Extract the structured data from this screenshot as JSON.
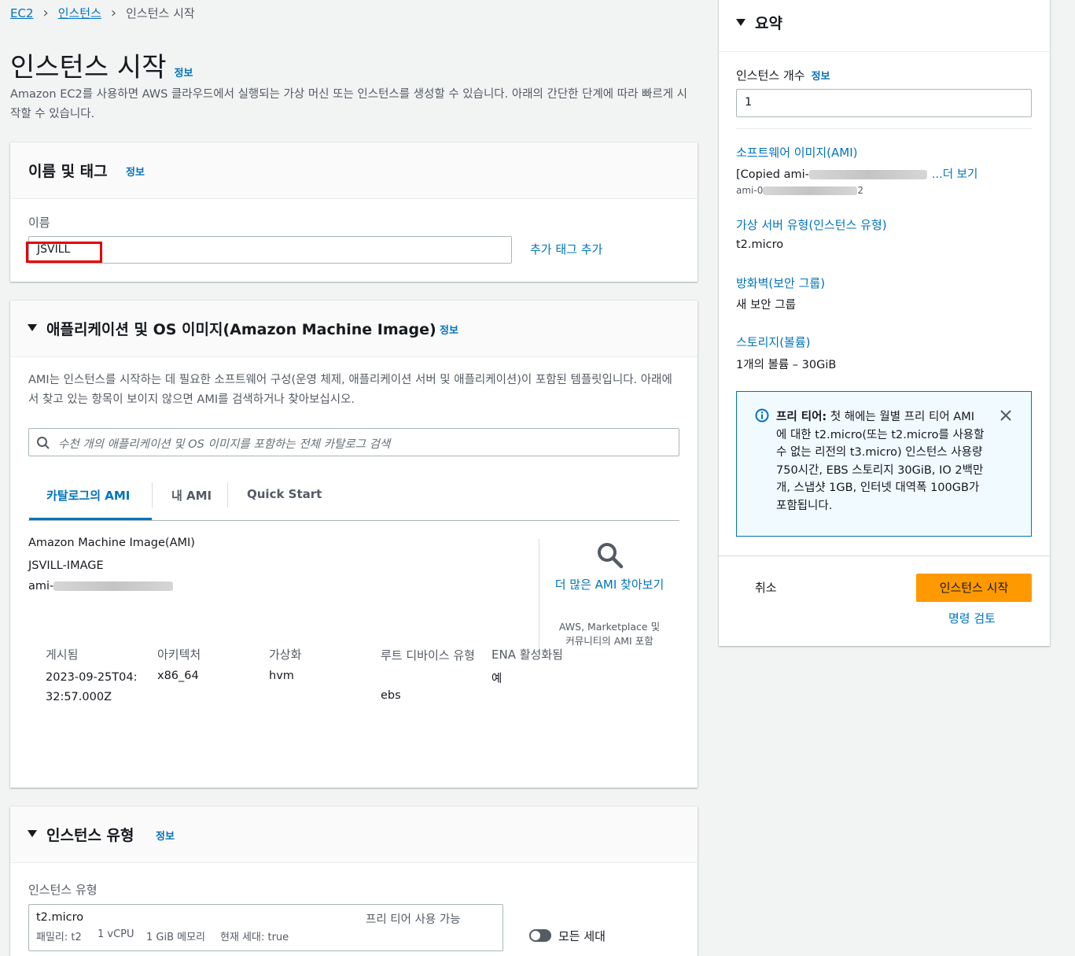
{
  "breadcrumb": {
    "root": "EC2",
    "parent": "인스턴스",
    "current": "인스턴스 시작"
  },
  "page": {
    "title": "인스턴스 시작",
    "info": "정보",
    "description": "Amazon EC2를 사용하면 AWS 클라우드에서 실행되는 가상 머신 또는 인스턴스를 생성할 수 있습니다. 아래의 간단한 단계에 따라 빠르게 시작할 수 있습니다."
  },
  "name_tags": {
    "title": "이름 및 태그",
    "info": "정보",
    "name_label": "이름",
    "name_value": "JSVILL",
    "add_tags": "추가 태그 추가"
  },
  "ami": {
    "title": "애플리케이션 및 OS 이미지(Amazon Machine Image)",
    "info": "정보",
    "description": "AMI는 인스턴스를 시작하는 데 필요한 소프트웨어 구성(운영 체제, 애플리케이션 서버 및 애플리케이션)이 포함된 템플릿입니다. 아래에서 찾고 있는 항목이 보이지 않으면 AMI를 검색하거나 찾아보십시오.",
    "search_placeholder": "수천 개의 애플리케이션 및 OS 이미지를 포함하는 전체 카탈로그 검색",
    "tabs": [
      "카탈로그의 AMI",
      "내 AMI",
      "Quick Start"
    ],
    "selected_label": "Amazon Machine Image(AMI)",
    "selected_name": "JSVILL-IMAGE",
    "selected_id_prefix": "ami-",
    "browse_more": "더 많은 AMI 찾아보기",
    "browse_sub": "AWS, Marketplace 및 커뮤니티의 AMI 포함",
    "details": [
      {
        "label": "게시됨",
        "value": "2023-09-25T04:32:57.000Z"
      },
      {
        "label": "아키텍처",
        "value": "x86_64"
      },
      {
        "label": "가상화",
        "value": "hvm"
      },
      {
        "label": "루트 디바이스 유형",
        "value": "ebs"
      },
      {
        "label": "ENA 활성화됨",
        "value": "예"
      }
    ]
  },
  "instance_type": {
    "title": "인스턴스 유형",
    "info": "정보",
    "label": "인스턴스 유형",
    "selected": "t2.micro",
    "free_tier": "프리 티어 사용 가능",
    "family": "패밀리: t2",
    "vcpu": "1 vCPU",
    "memory": "1 GiB 메모리",
    "generation": "현재 세대: true",
    "all_generations": "모든 세대"
  },
  "summary": {
    "title": "요약",
    "count_label": "인스턴스 개수",
    "info": "정보",
    "count_value": "1",
    "ami_label": "소프트웨어 이미지(AMI)",
    "ami_value_prefix": "[Copied ami-",
    "ami_more": "...더 보기",
    "ami_id_prefix": "ami-0",
    "ami_id_suffix": "2",
    "type_label": "가상 서버 유형(인스턴스 유형)",
    "type_value": "t2.micro",
    "firewall_label": "방화벽(보안 그룹)",
    "firewall_value": "새 보안 그룹",
    "storage_label": "스토리지(볼륨)",
    "storage_value": "1개의 볼륨 – 30GiB",
    "free_tier_title": "프리 티어:",
    "free_tier_text": "첫 해에는 월별 프리 티어 AMI에 대한 t2.micro(또는 t2.micro를 사용할 수 없는 리전의 t3.micro) 인스턴스 사용량 750시간, EBS 스토리지 30GiB, IO 2백만 개, 스냅샷 1GB, 인터넷 대역폭 100GB가 포함됩니다.",
    "cancel": "취소",
    "launch": "인스턴스 시작",
    "review": "명령 검토"
  },
  "colors": {
    "link": "#0073bb",
    "primary": "#ff9900",
    "highlight": "#e60000",
    "info_bg": "#f1faff"
  }
}
